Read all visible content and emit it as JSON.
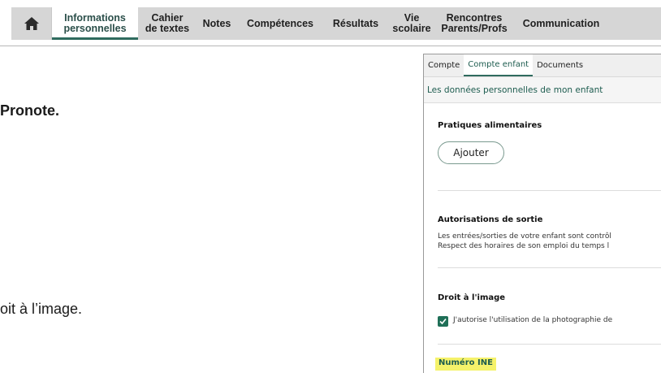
{
  "topnav": {
    "home_icon": "home-icon",
    "items": [
      {
        "label": "Informations\npersonnelles",
        "active": true
      },
      {
        "label": "Cahier\nde textes",
        "active": false
      },
      {
        "label": "Notes",
        "active": false
      },
      {
        "label": "Compétences",
        "active": false
      },
      {
        "label": "Résultats",
        "active": false
      },
      {
        "label": "Vie\nscolaire",
        "active": false
      },
      {
        "label": "Rencontres\nParents/Profs",
        "active": false
      },
      {
        "label": "Communication",
        "active": false
      }
    ]
  },
  "left": {
    "line1": "Pronote.",
    "line2": "oit à l’image."
  },
  "panel": {
    "tabs": [
      "Compte",
      "Compte enfant",
      "Documents"
    ],
    "active_tab": "Compte enfant",
    "header": "Les données personnelles de mon enfant",
    "food": {
      "title": "Pratiques alimentaires",
      "button": "Ajouter"
    },
    "exit": {
      "title": "Autorisations de sortie",
      "line1": "Les entrées/sorties de votre enfant sont contrôl",
      "line2": "Respect des horaires de son emploi du temps l"
    },
    "image_right": {
      "title": "Droit à l'image",
      "checked": true,
      "checkbox_label": "J'autorise l'utilisation de la photographie de"
    },
    "ine": {
      "title": "Numéro INE",
      "highlight": "#f5f26a"
    }
  },
  "colors": {
    "accent": "#2f6b5e",
    "nav_bg": "#d6d6d6"
  }
}
